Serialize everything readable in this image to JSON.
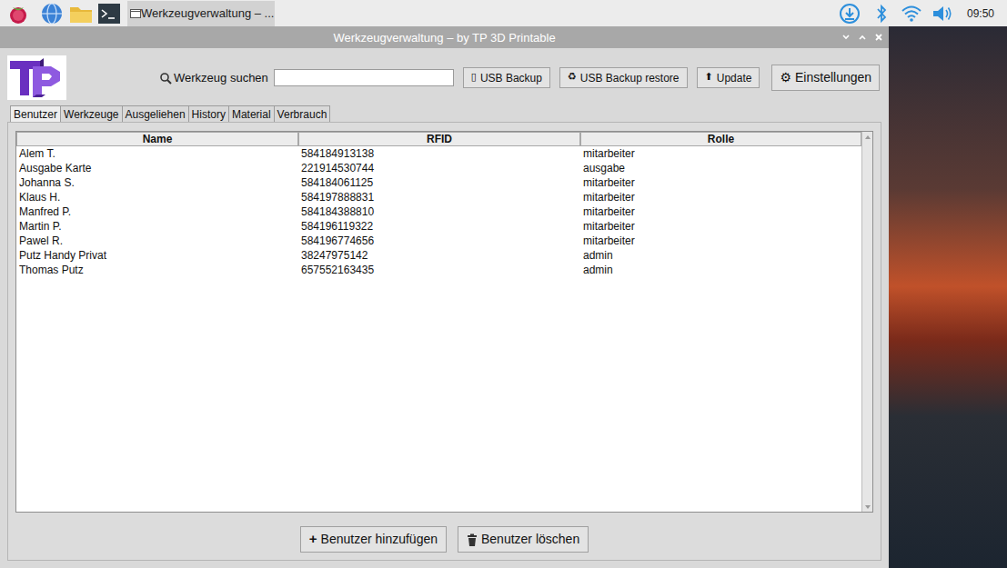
{
  "taskbar": {
    "task": "Werkzeugverwaltung – ...",
    "clock": "09:50"
  },
  "window": {
    "title": "Werkzeugverwaltung – by TP 3D Printable"
  },
  "toolbar": {
    "search_label": "Werkzeug suchen",
    "search_value": "",
    "buttons": [
      {
        "icon": "▯",
        "label": "USB Backup",
        "kind": "normal"
      },
      {
        "icon": "♻",
        "label": "USB Backup restore",
        "kind": "normal"
      },
      {
        "icon": "⬆",
        "label": "Update",
        "kind": "normal"
      },
      {
        "icon": "⚙",
        "label": "Einstellungen",
        "kind": "large"
      }
    ]
  },
  "tabs": [
    {
      "label": "Benutzer",
      "selected": true
    },
    {
      "label": "Werkzeuge",
      "selected": false
    },
    {
      "label": "Ausgeliehen",
      "selected": false
    },
    {
      "label": "History",
      "selected": false
    },
    {
      "label": "Material",
      "selected": false
    },
    {
      "label": "Verbrauch",
      "selected": false
    }
  ],
  "table": {
    "columns": [
      "Name",
      "RFID",
      "Rolle"
    ],
    "rows": [
      [
        "Alem T.",
        "584184913138",
        "mitarbeiter"
      ],
      [
        "Ausgabe Karte",
        "221914530744",
        "ausgabe"
      ],
      [
        "Johanna S.",
        "584184061125",
        "mitarbeiter"
      ],
      [
        "Klaus H.",
        "584197888831",
        "mitarbeiter"
      ],
      [
        "Manfred P.",
        "584184388810",
        "mitarbeiter"
      ],
      [
        "Martin P.",
        "584196119322",
        "mitarbeiter"
      ],
      [
        "Pawel R.",
        "584196774656",
        "mitarbeiter"
      ],
      [
        "Putz Handy Privat",
        "38247975142",
        "admin"
      ],
      [
        "Thomas Putz",
        "657552163435",
        "admin"
      ]
    ]
  },
  "actions": [
    {
      "icon": "+",
      "label": "Benutzer hinzufügen"
    },
    {
      "label": "Benutzer löschen"
    }
  ]
}
